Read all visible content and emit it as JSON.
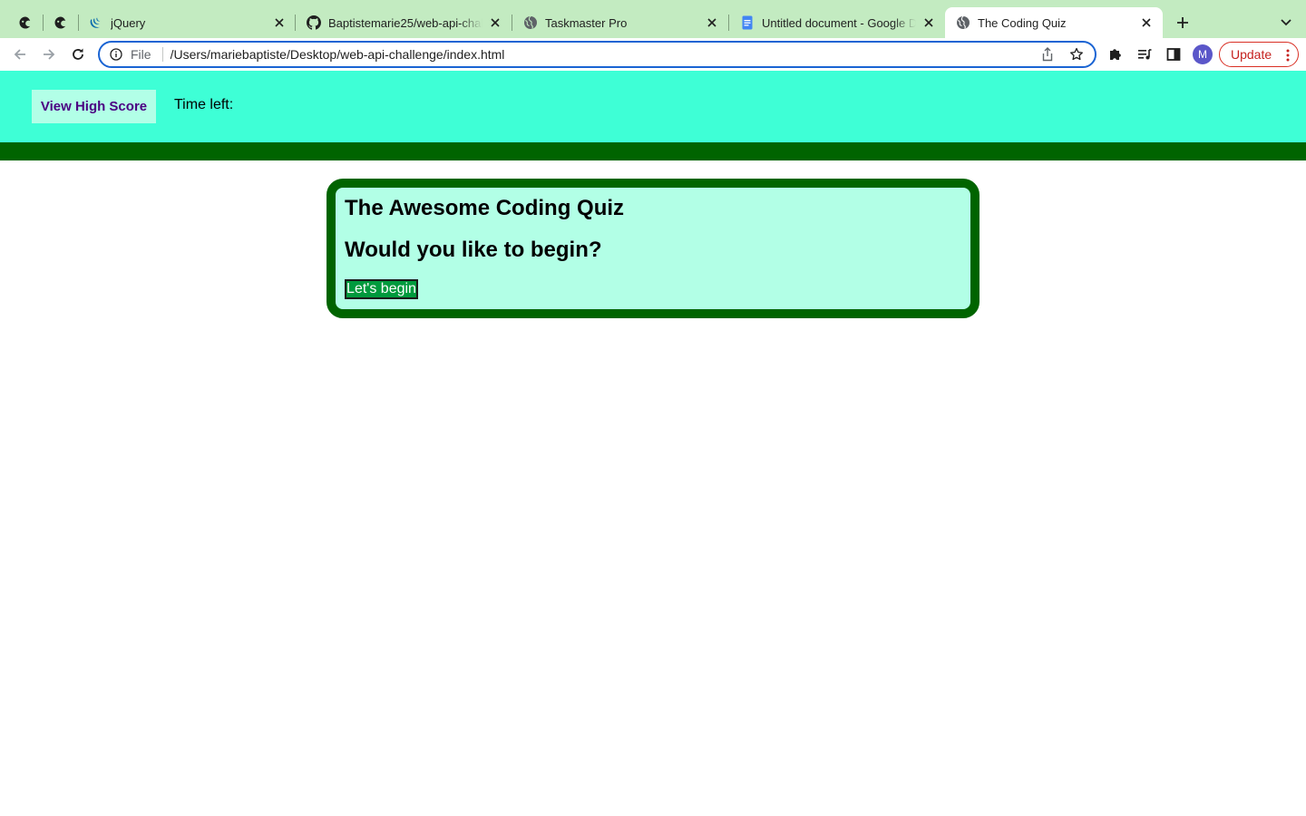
{
  "browser": {
    "tabs": [
      {
        "title": "jQuery",
        "icon": "jquery-icon"
      },
      {
        "title": "Baptistemarie25/web-api-challenge",
        "icon": "github-icon"
      },
      {
        "title": "Taskmaster Pro",
        "icon": "globe-icon"
      },
      {
        "title": "Untitled document - Google Docs",
        "icon": "google-docs-icon"
      },
      {
        "title": "The Coding Quiz",
        "icon": "globe-icon",
        "active": true
      }
    ],
    "pinned_tabs": [
      "pinned-tab-icon",
      "pinned-tab-icon"
    ],
    "address_bar": {
      "scheme_label": "File",
      "url": "/Users/mariebaptiste/Desktop/web-api-challenge/index.html"
    },
    "avatar_letter": "M",
    "update_label": "Update"
  },
  "page": {
    "header": {
      "high_score_label": "View High Score",
      "time_left_label": "Time left:"
    },
    "quiz": {
      "title": "The Awesome Coding Quiz",
      "question": "Would you like to begin?",
      "start_label": "Let's begin"
    }
  },
  "colors": {
    "header_bg": "#3effd6",
    "stripe": "#006400",
    "card_bg": "#b2ffe6",
    "card_border": "#006400",
    "high_score_bg": "#b2ffe7",
    "high_score_text": "#4b0082",
    "start_button_bg": "#009a3d",
    "tab_strip": "#c3ebc1"
  }
}
